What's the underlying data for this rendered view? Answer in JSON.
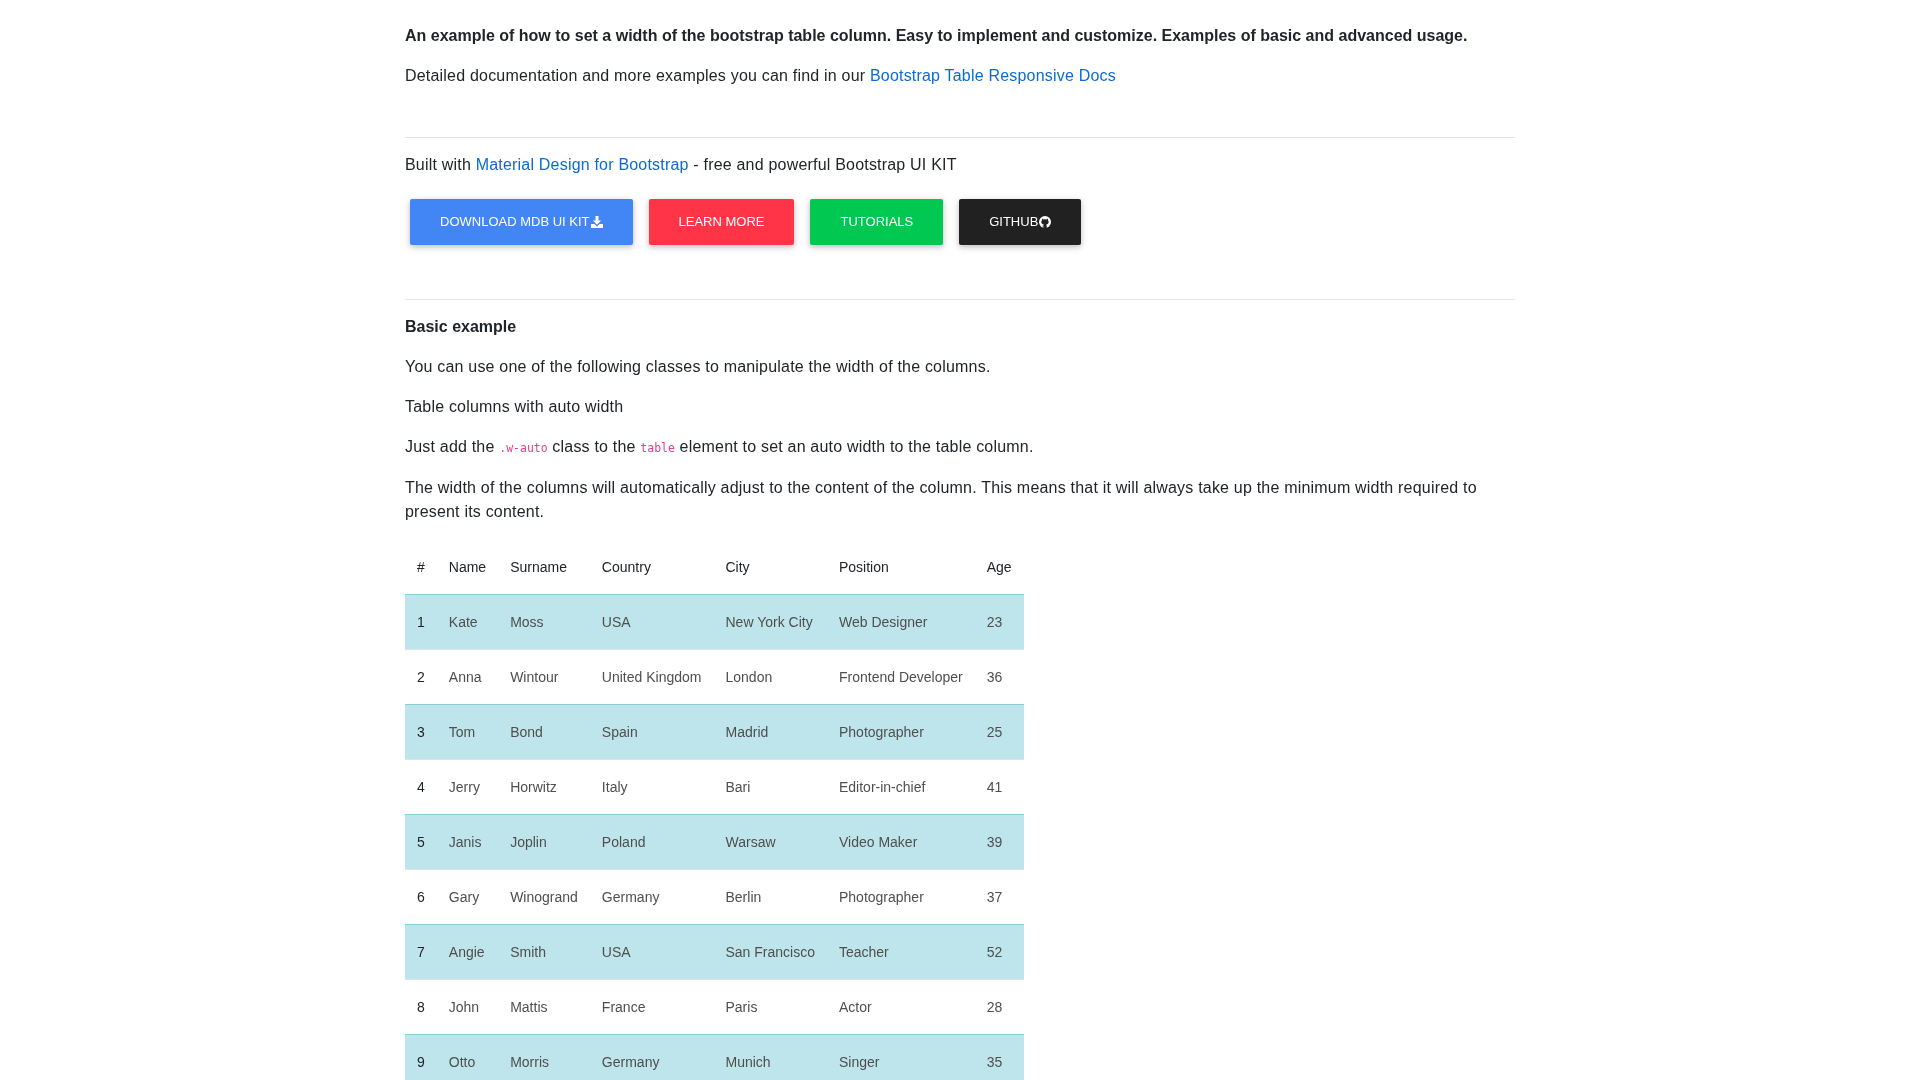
{
  "intro": {
    "paragraphs": [
      {
        "kind": "lead",
        "text": "An example of how to set a width of the bootstrap table column. Easy to implement and customize. Examples of basic and advanced usage."
      },
      {
        "kind": "text",
        "parts": [
          {
            "kind": "text",
            "text": "Detailed documentation and more examples you can find in our "
          },
          {
            "kind": "link",
            "text": "Bootstrap Table Responsive Docs"
          }
        ]
      }
    ]
  },
  "promo": {
    "paragraphs": [
      {
        "kind": "text",
        "parts": [
          {
            "kind": "text",
            "text": "Built with "
          },
          {
            "kind": "link",
            "text": "Material Design for Bootstrap"
          },
          {
            "kind": "text",
            "text": " - free and powerful Bootstrap UI KIT"
          }
        ]
      }
    ],
    "buttons": [
      {
        "kind": "download",
        "label": "DOWNLOAD MDB UI KIT",
        "color": "#4285f4"
      },
      {
        "kind": "plain",
        "label": "LEARN MORE",
        "color": "#ff3547"
      },
      {
        "kind": "plain",
        "label": "TUTORIALS",
        "color": "#00c851"
      },
      {
        "kind": "cat",
        "label": "GITHUB",
        "color": "#212121"
      }
    ]
  },
  "basic_example": {
    "paragraphs": [
      {
        "kind": "heading",
        "text": "Basic example"
      },
      {
        "kind": "text",
        "text": "You can use one of the following classes to manipulate the width of the columns."
      },
      {
        "kind": "text",
        "text": "Table columns with auto width"
      },
      {
        "kind": "text",
        "parts": [
          {
            "kind": "text",
            "text": "Just add the "
          },
          {
            "kind": "code",
            "text": ".w-auto"
          },
          {
            "kind": "text",
            "text": " class to the "
          },
          {
            "kind": "code",
            "text": "table"
          },
          {
            "kind": "text",
            "text": " element to set an auto width to the table column."
          }
        ]
      },
      {
        "kind": "text",
        "text": "The width of the columns will automatically adjust to the content of the column. This means that it will always take up the minimum width required to present its content."
      }
    ],
    "table": {
      "columns": [
        "#",
        "Name",
        "Surname",
        "Country",
        "City",
        "Position",
        "Age"
      ],
      "rows": [
        {
          "highlighted": true,
          "cells": [
            "1",
            "Kate",
            "Moss",
            "USA",
            "New York City",
            "Web Designer",
            "23"
          ]
        },
        {
          "highlighted": false,
          "cells": [
            "2",
            "Anna",
            "Wintour",
            "United Kingdom",
            "London",
            "Frontend Developer",
            "36"
          ]
        },
        {
          "highlighted": true,
          "cells": [
            "3",
            "Tom",
            "Bond",
            "Spain",
            "Madrid",
            "Photographer",
            "25"
          ]
        },
        {
          "highlighted": false,
          "cells": [
            "4",
            "Jerry",
            "Horwitz",
            "Italy",
            "Bari",
            "Editor-in-chief",
            "41"
          ]
        },
        {
          "highlighted": true,
          "cells": [
            "5",
            "Janis",
            "Joplin",
            "Poland",
            "Warsaw",
            "Video Maker",
            "39"
          ]
        },
        {
          "highlighted": false,
          "cells": [
            "6",
            "Gary",
            "Winogrand",
            "Germany",
            "Berlin",
            "Photographer",
            "37"
          ]
        },
        {
          "highlighted": true,
          "cells": [
            "7",
            "Angie",
            "Smith",
            "USA",
            "San Francisco",
            "Teacher",
            "52"
          ]
        },
        {
          "highlighted": false,
          "cells": [
            "8",
            "John",
            "Mattis",
            "France",
            "Paris",
            "Actor",
            "28"
          ]
        },
        {
          "highlighted": true,
          "cells": [
            "9",
            "Otto",
            "Morris",
            "Germany",
            "Munich",
            "Singer",
            "35"
          ]
        }
      ]
    }
  }
}
